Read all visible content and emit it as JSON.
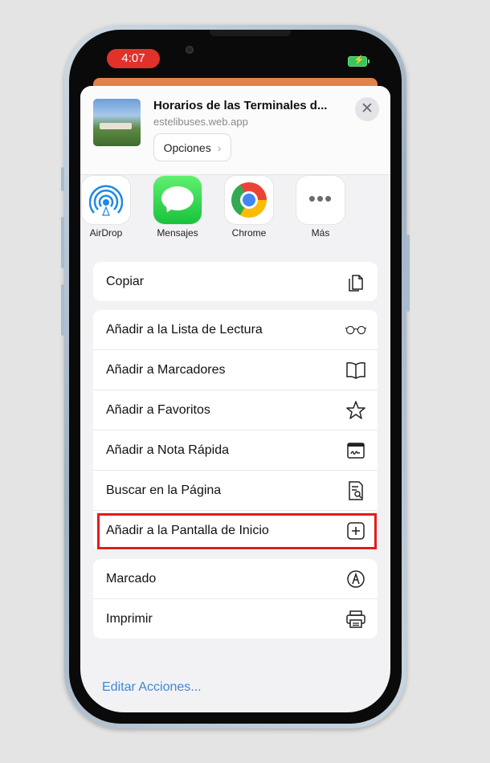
{
  "status_bar": {
    "time": "4:07"
  },
  "share_sheet": {
    "title": "Horarios de las Terminales d...",
    "subtitle": "estelibuses.web.app",
    "options_label": "Opciones",
    "apps": [
      {
        "label": "AirDrop",
        "icon": "airdrop-icon"
      },
      {
        "label": "Mensajes",
        "icon": "messages-icon"
      },
      {
        "label": "Chrome",
        "icon": "chrome-icon"
      },
      {
        "label": "Más",
        "icon": "more-icon"
      }
    ],
    "actions_group1": [
      {
        "label": "Copiar",
        "icon": "copy-icon"
      }
    ],
    "actions_group2": [
      {
        "label": "Añadir a la Lista de Lectura",
        "icon": "glasses-icon"
      },
      {
        "label": "Añadir a Marcadores",
        "icon": "book-icon"
      },
      {
        "label": "Añadir a Favoritos",
        "icon": "star-icon"
      },
      {
        "label": "Añadir a Nota Rápida",
        "icon": "quick-note-icon"
      },
      {
        "label": "Buscar en la Página",
        "icon": "find-in-page-icon"
      },
      {
        "label": "Añadir a la Pantalla de Inicio",
        "icon": "add-square-icon"
      }
    ],
    "actions_group3": [
      {
        "label": "Marcado",
        "icon": "markup-icon"
      },
      {
        "label": "Imprimir",
        "icon": "printer-icon"
      }
    ],
    "edit_actions": "Editar Acciones..."
  },
  "colors": {
    "highlight": "#e41b1b",
    "link": "#3f87cf",
    "time_pill": "#e0322a"
  }
}
